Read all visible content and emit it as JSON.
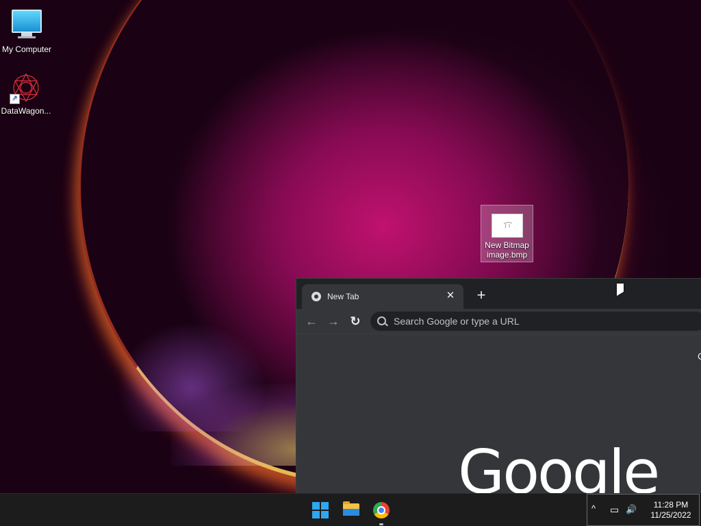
{
  "desktop": {
    "icons": [
      {
        "label": "My Computer"
      },
      {
        "label": "DataWagon..."
      }
    ],
    "file_icon": {
      "label_line1": "New Bitmap",
      "label_line2": "image.bmp"
    }
  },
  "browser": {
    "tab": {
      "title": "New Tab",
      "close": "✕"
    },
    "new_tab": "+",
    "nav": {
      "back": "←",
      "forward": "→",
      "reload": "↻"
    },
    "omnibox": {
      "placeholder": "Search Google or type a URL"
    },
    "share": "⇪",
    "content": {
      "logo": "Google",
      "edge_glyph": "C"
    }
  },
  "taskbar": {
    "apps": [
      "start",
      "file-explorer",
      "chrome"
    ],
    "tray": {
      "chevron": "^",
      "network": "▭",
      "volume": "🔊"
    },
    "clock": {
      "time": "11:28 PM",
      "date": "11/25/2022"
    }
  },
  "colors": {
    "windows_accent": "#2fa7f0",
    "chrome_dark": "#202124",
    "chrome_toolbar": "#35363a"
  }
}
